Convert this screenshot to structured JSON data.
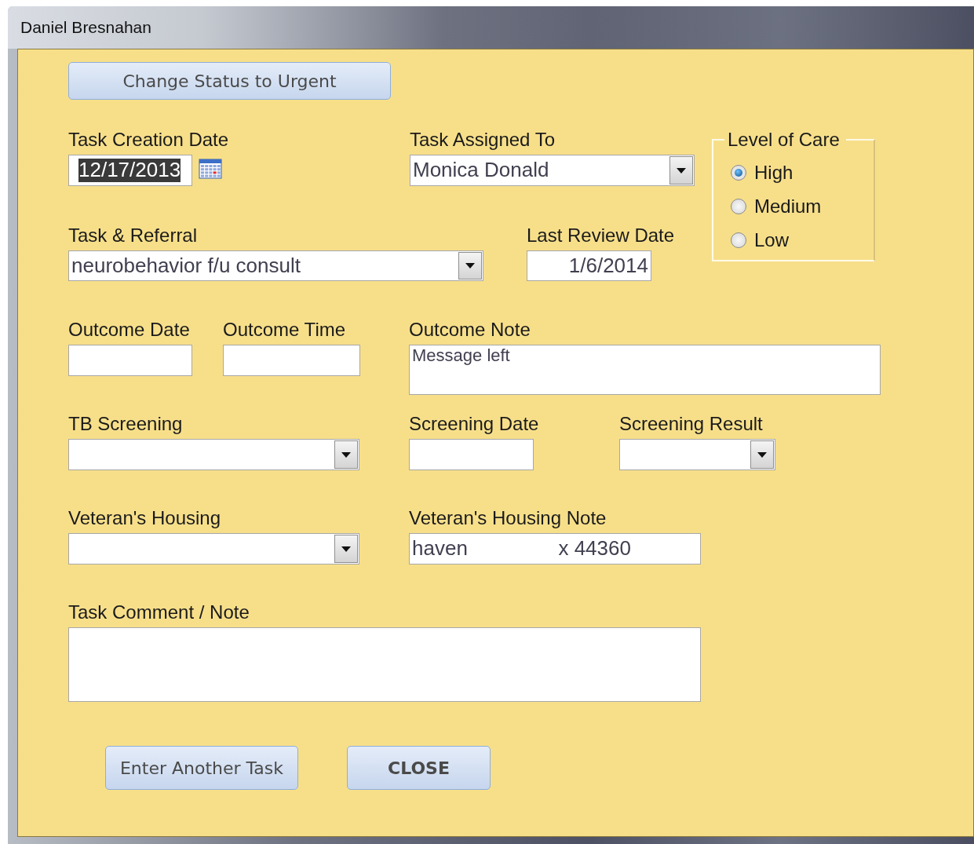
{
  "window": {
    "title": "Daniel Bresnahan"
  },
  "urgent_button": {
    "label": "Change Status to Urgent"
  },
  "fields": [
    {
      "kind": "date",
      "label": "Task Creation Date",
      "value": "12/17/2013",
      "highlighted": true
    },
    {
      "kind": "combo",
      "label": "Task Assigned To",
      "value": "Monica Donald"
    },
    {
      "kind": "combo",
      "label": "Task & Referral",
      "value": "neurobehavior f/u consult"
    },
    {
      "kind": "text",
      "label": "Last Review Date",
      "value": "1/6/2014",
      "right_aligned": true
    },
    {
      "kind": "text",
      "label": "Outcome Date"
    },
    {
      "kind": "text",
      "label": "Outcome Time"
    },
    {
      "kind": "memo",
      "label": "Outcome Note",
      "value": "Message left"
    },
    {
      "kind": "combo",
      "label": "TB Screening"
    },
    {
      "kind": "text",
      "label": "Screening Date"
    },
    {
      "kind": "combo",
      "label": "Screening Result"
    },
    {
      "kind": "combo",
      "label": "Veteran's Housing"
    },
    {
      "kind": "text",
      "label": "Veteran's Housing Note",
      "value": "haven                x 44360"
    },
    {
      "kind": "memo",
      "label": "Task Comment / Note"
    }
  ],
  "level_of_care": {
    "legend": "Level of Care",
    "options": [
      {
        "label": "High",
        "selected": true
      },
      {
        "label": "Medium",
        "selected": false
      },
      {
        "label": "Low",
        "selected": false
      }
    ]
  },
  "buttons": [
    {
      "label": "Enter Another Task",
      "bold": false
    },
    {
      "label": "CLOSE",
      "bold": true
    }
  ]
}
